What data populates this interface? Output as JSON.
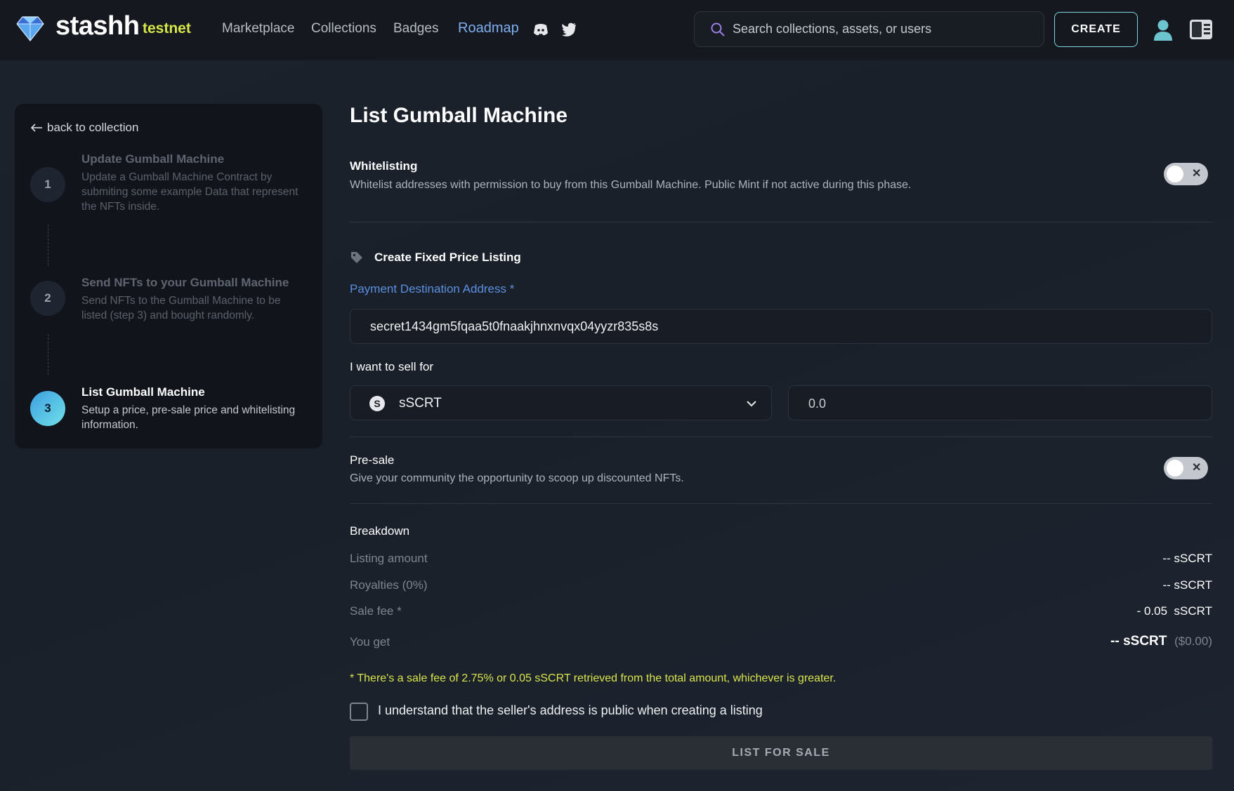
{
  "header": {
    "brand": "stashh",
    "network": "testnet",
    "nav": [
      "Marketplace",
      "Collections",
      "Badges",
      "Roadmap"
    ],
    "search_placeholder": "Search collections, assets, or users",
    "create_label": "CREATE"
  },
  "sidebar": {
    "back_label": "back to collection",
    "steps": [
      {
        "number": "1",
        "title": "Update Gumball Machine",
        "description": "Update a Gumball Machine Contract by submiting some example Data that represent the NFTs inside."
      },
      {
        "number": "2",
        "title": "Send NFTs to your Gumball Machine",
        "description": "Send NFTs to the Gumball Machine to be listed (step 3) and bought randomly."
      },
      {
        "number": "3",
        "title": "List Gumball Machine",
        "description": "Setup a price, pre-sale price and whitelisting information."
      }
    ]
  },
  "main": {
    "title": "List Gumball Machine",
    "whitelisting": {
      "label": "Whitelisting",
      "description": "Whitelist addresses with permission to buy from this Gumball Machine. Public Mint if not active during this phase."
    },
    "fixed_price": {
      "heading": "Create Fixed Price Listing",
      "payment_label": "Payment Destination Address *",
      "payment_value": "secret1434gm5fqaa5t0fnaakjhnxnvqx04yyzr835s8s",
      "sell_label": "I want to sell for",
      "currency": "sSCRT",
      "amount": "0.0"
    },
    "presale": {
      "label": "Pre-sale",
      "description": "Give your community the opportunity to scoop up discounted NFTs."
    },
    "breakdown": {
      "heading": "Breakdown",
      "rows": [
        {
          "label": "Listing amount",
          "value": "-- sSCRT"
        },
        {
          "label": "Royalties (0%)",
          "value": "-- sSCRT"
        },
        {
          "label": "Sale fee *",
          "value": "- 0.05  sSCRT"
        }
      ],
      "you_get_label": "You get",
      "you_get_value": "-- sSCRT",
      "you_get_usd": "($0.00)"
    },
    "note": "* There's a sale fee of 2.75% or 0.05 sSCRT retrieved from the total amount, whichever is greater.",
    "agreement": "I understand that the seller's address is public when creating a listing",
    "submit_label": "LIST FOR SALE"
  }
}
